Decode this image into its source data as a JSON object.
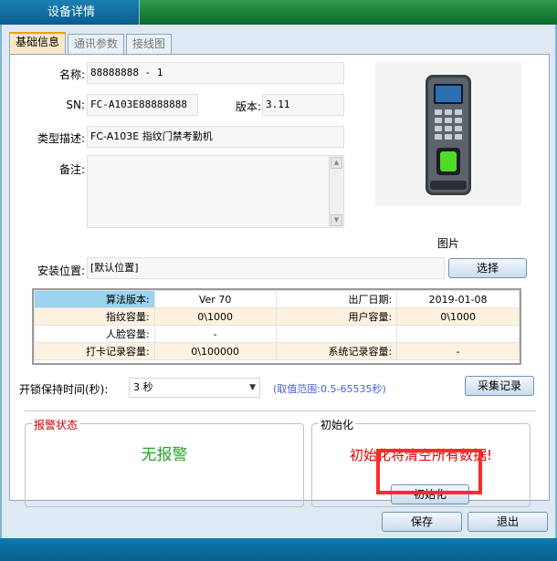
{
  "window": {
    "title": "设备详情"
  },
  "tabs": [
    {
      "label": "基础信息"
    },
    {
      "label": "通讯参数"
    },
    {
      "label": "接线图"
    }
  ],
  "basic": {
    "name_label": "名称:",
    "name_value": "88888888 - 1",
    "sn_label": "SN:",
    "sn_value": "FC-A103E88888888",
    "version_label": "版本:",
    "version_value": "3.11",
    "type_label": "类型描述:",
    "type_value": "FC-A103E 指纹门禁考勤机",
    "note_label": "备注:",
    "note_value": "",
    "image_caption": "图片",
    "location_label": "安装位置:",
    "location_value": "[默认位置]",
    "select_button": "选择"
  },
  "info_table": {
    "rows": [
      [
        "算法版本:",
        "Ver 70",
        "出厂日期:",
        "2019-01-08"
      ],
      [
        "指纹容量:",
        "0\\1000",
        "用户容量:",
        "0\\1000"
      ],
      [
        "人脸容量:",
        "-",
        "",
        ""
      ],
      [
        "打卡记录容量:",
        "0\\100000",
        "系统记录容量:",
        "-"
      ]
    ]
  },
  "unlock": {
    "label": "开锁保持时间(秒):",
    "value": "3 秒",
    "range_hint": "(取值范围:0.5-65535秒)",
    "collect_button": "采集记录"
  },
  "alarm": {
    "title": "报警状态",
    "status": "无报警"
  },
  "init": {
    "title": "初始化",
    "warning": "初始化将清空所有数据!",
    "button": "初始化"
  },
  "footer": {
    "save_button": "保存",
    "exit_button": "退出"
  },
  "colors": {
    "alarm_title": "#cc0000",
    "alarm_status": "#2aa02a",
    "init_warning": "#e00000",
    "range_hint": "#4a5fd6",
    "highlight_box": "#ff2a2a"
  }
}
